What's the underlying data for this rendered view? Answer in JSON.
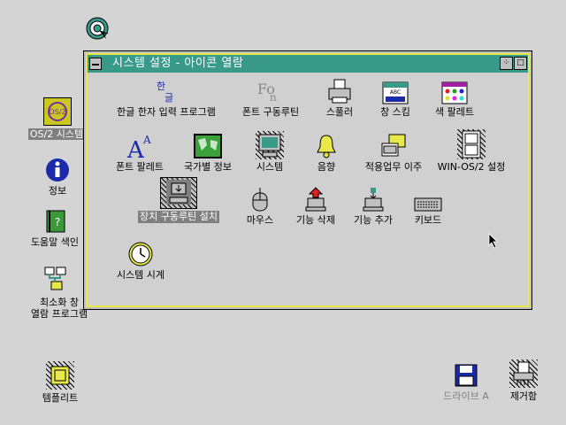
{
  "window": {
    "title": "시스템 설정 - 아이콘 열람",
    "items": [
      {
        "name": "hangul-input-icon",
        "label": "한글 한자 입력 프로그램"
      },
      {
        "name": "font-driver-icon",
        "label": "폰트 구동루틴"
      },
      {
        "name": "spooler-icon",
        "label": "스풀러"
      },
      {
        "name": "window-scheme-icon",
        "label": "창 스킴"
      },
      {
        "name": "color-palette-icon",
        "label": "색 팔레트"
      },
      {
        "name": "font-palette-icon",
        "label": "폰트 팔레트"
      },
      {
        "name": "country-info-icon",
        "label": "국가별 정보"
      },
      {
        "name": "system-icon",
        "label": "시스템"
      },
      {
        "name": "sound-icon",
        "label": "음향"
      },
      {
        "name": "migrate-apps-icon",
        "label": "적용업무 이주"
      },
      {
        "name": "win-os2-setup-icon",
        "label": "WIN-OS/2 설정"
      },
      {
        "name": "device-driver-install-icon",
        "label": "장치 구동루틴 설치"
      },
      {
        "name": "mouse-icon",
        "label": "마우스"
      },
      {
        "name": "delete-feature-icon",
        "label": "기능 삭제"
      },
      {
        "name": "add-feature-icon",
        "label": "기능 추가"
      },
      {
        "name": "keyboard-icon",
        "label": "키보드"
      },
      {
        "name": "system-clock-icon",
        "label": "시스템 시계"
      }
    ]
  },
  "desktop": {
    "top_icon_label": "정보 …",
    "os2_system": "OS/2 시스템",
    "info": "정보",
    "help_index": "도움말 색인",
    "minimized_viewer_1": "최소화 창",
    "minimized_viewer_2": "열람 프로그램",
    "templates": "템플리트",
    "drive_a": "드라이브 A",
    "shredder": "제거함"
  },
  "colors": {
    "titlebar": "#3a9a8a",
    "window_frame": "#e8e84a",
    "desktop": "#d4d4d4",
    "selection": "#808080"
  }
}
